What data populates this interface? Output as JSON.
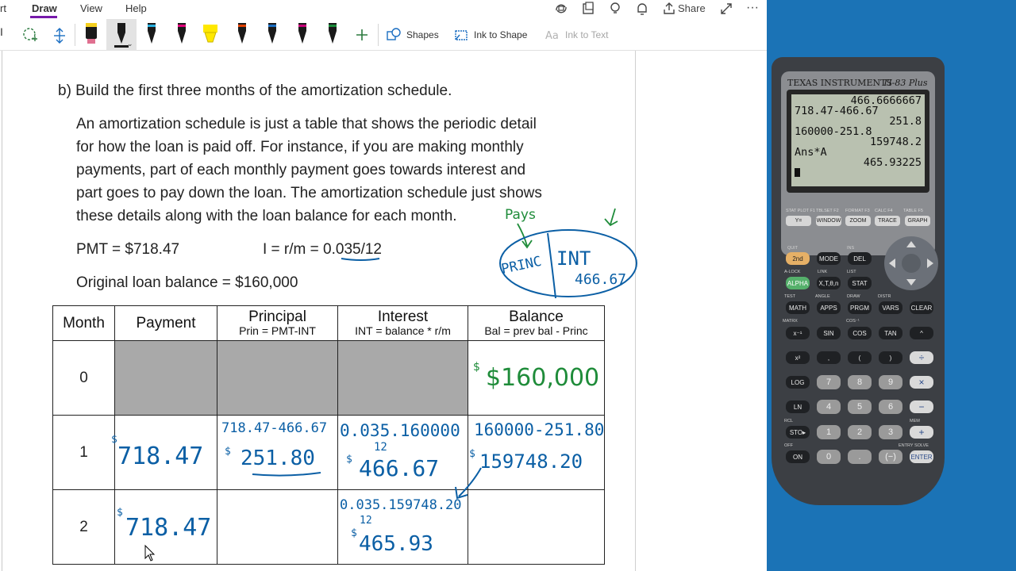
{
  "ribbon": {
    "tabs": [
      "rt",
      "Draw",
      "View",
      "Help"
    ],
    "share_label": "Share"
  },
  "toolbar": {
    "shapes_label": "Shapes",
    "ink_to_shape_label": "Ink to Shape",
    "ink_to_text_label": "Ink to Text",
    "pen_colors": [
      "#f5d020",
      "#1a1a1a",
      "#1a1a1a",
      "#e0007a",
      "#ffe800",
      "#e04000",
      "#1a1a1a",
      "#c8007a",
      "#1a8c3a"
    ],
    "accent": "#7719aa"
  },
  "page": {
    "heading": "b) Build the first three months of the amortization schedule.",
    "paragraph": [
      "An amortization schedule is just a table that shows the periodic detail",
      "for how the loan is paid off.  For instance, if you are making monthly",
      "payments, part of each monthly payment goes towards interest and",
      "part goes to pay down the loan.  The amortization schedule just shows",
      "these details along with the loan balance for each month."
    ],
    "pmt": "PMT = $718.47",
    "rate_prefix": "I = r/m = ",
    "rate_value": "0.035",
    "rate_suffix": "/12",
    "original_balance": "Original loan balance = $160,000"
  },
  "table": {
    "headers": [
      {
        "main": "Month",
        "sub": ""
      },
      {
        "main": "Payment",
        "sub": ""
      },
      {
        "main": "Principal",
        "sub": "Prin = PMT-INT"
      },
      {
        "main": "Interest",
        "sub": "INT = balance * r/m"
      },
      {
        "main": "Balance",
        "sub": "Bal = prev bal - Princ"
      }
    ],
    "months": [
      "0",
      "1",
      "2"
    ]
  },
  "ink": {
    "row0_balance": "$160,000",
    "row1_payment": "718.47",
    "row1_principal_work": "718.47-466.67",
    "row1_principal": "251.80",
    "row1_interest_work": "0.035.160000",
    "row1_interest_den": "12",
    "row1_interest": "466.67",
    "row1_balance_work": "160000-251.80",
    "row1_balance": "159748.20",
    "row2_payment": "718.47",
    "row2_interest_work": "0.035.159748.20",
    "row2_interest_den": "12",
    "row2_interest": "465.93",
    "note_pays": "Pays",
    "note_princ": "PRINC",
    "note_int": "INT",
    "note_int_value": "466.67",
    "dollar": "$",
    "ink_blue": "#0b5fa5",
    "ink_green": "#1f8c3a"
  },
  "calculator": {
    "brand": "TEXAS INSTRUMENTS",
    "model": "TI-83 Plus",
    "screen": [
      {
        "align": "r",
        "text": "466.6666667"
      },
      {
        "align": "l",
        "text": "718.47-466.67"
      },
      {
        "align": "r",
        "text": "251.8"
      },
      {
        "align": "l",
        "text": "160000-251.8"
      },
      {
        "align": "r",
        "text": "159748.2"
      },
      {
        "align": "l",
        "text": "Ans*A"
      },
      {
        "align": "r",
        "text": "465.93225"
      }
    ],
    "fkeys": [
      "Y=",
      "WINDOW",
      "ZOOM",
      "TRACE",
      "GRAPH"
    ],
    "fkey_labels": [
      "STAT PLOT F1",
      "TBLSET F2",
      "FORMAT F3",
      "CALC F4",
      "TABLE F5"
    ],
    "keys": {
      "second": "2nd",
      "mode": "MODE",
      "del": "DEL",
      "alpha": "ALPHA",
      "xton": "X,T,θ,n",
      "stat": "STAT",
      "math": "MATH",
      "apps": "APPS",
      "prgm": "PRGM",
      "vars": "VARS",
      "clear": "CLEAR",
      "inv": "x⁻¹",
      "sin": "SIN",
      "cos": "COS",
      "tan": "TAN",
      "pow": "^",
      "sq": "x²",
      "comma": ",",
      "lparen": "(",
      "rparen": ")",
      "div": "÷",
      "log": "LOG",
      "seven": "7",
      "eight": "8",
      "nine": "9",
      "mul": "×",
      "ln": "LN",
      "four": "4",
      "five": "5",
      "six": "6",
      "minus": "−",
      "sto": "STO▸",
      "one": "1",
      "two": "2",
      "three": "3",
      "plus": "+",
      "on": "ON",
      "zero": "0",
      "dot": ".",
      "neg": "(−)",
      "enter": "ENTER"
    },
    "key_labels": {
      "quit": "QUIT",
      "ins": "INS",
      "alock": "A-LOCK",
      "link": "LINK",
      "list": "LIST",
      "test": "TEST",
      "angle": "ANGLE",
      "draw": "DRAW",
      "distr": "DISTR",
      "matrx": "MATRX",
      "cos1": "COS⁻¹",
      "rcl": "RCL",
      "mem": "MEM",
      "entry": "ENTRY SOLVE",
      "off": "OFF"
    },
    "bg_blue": "#1b73b6"
  }
}
